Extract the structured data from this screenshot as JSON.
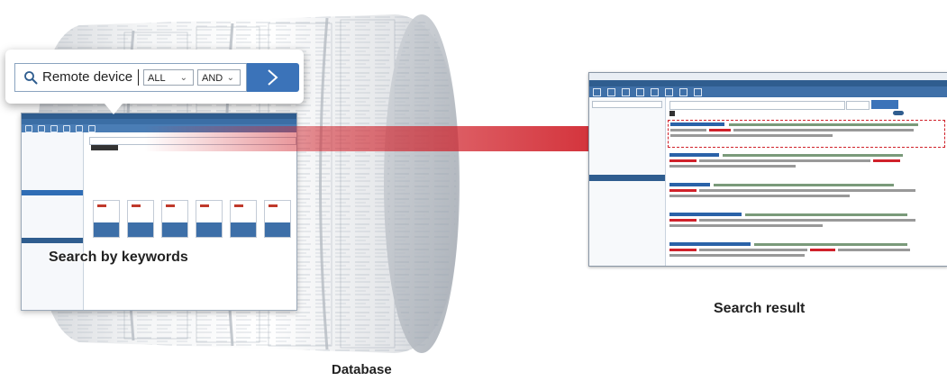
{
  "search_popup": {
    "query": "Remote device",
    "scope_option": "ALL",
    "operator_option": "AND"
  },
  "labels": {
    "search_by_keywords": "Search by keywords",
    "database": "Database",
    "search_result": "Search result"
  },
  "colors": {
    "arrow": "#d0212a",
    "accent_blue": "#3b73b9",
    "dark_blue": "#2f5d8f"
  }
}
